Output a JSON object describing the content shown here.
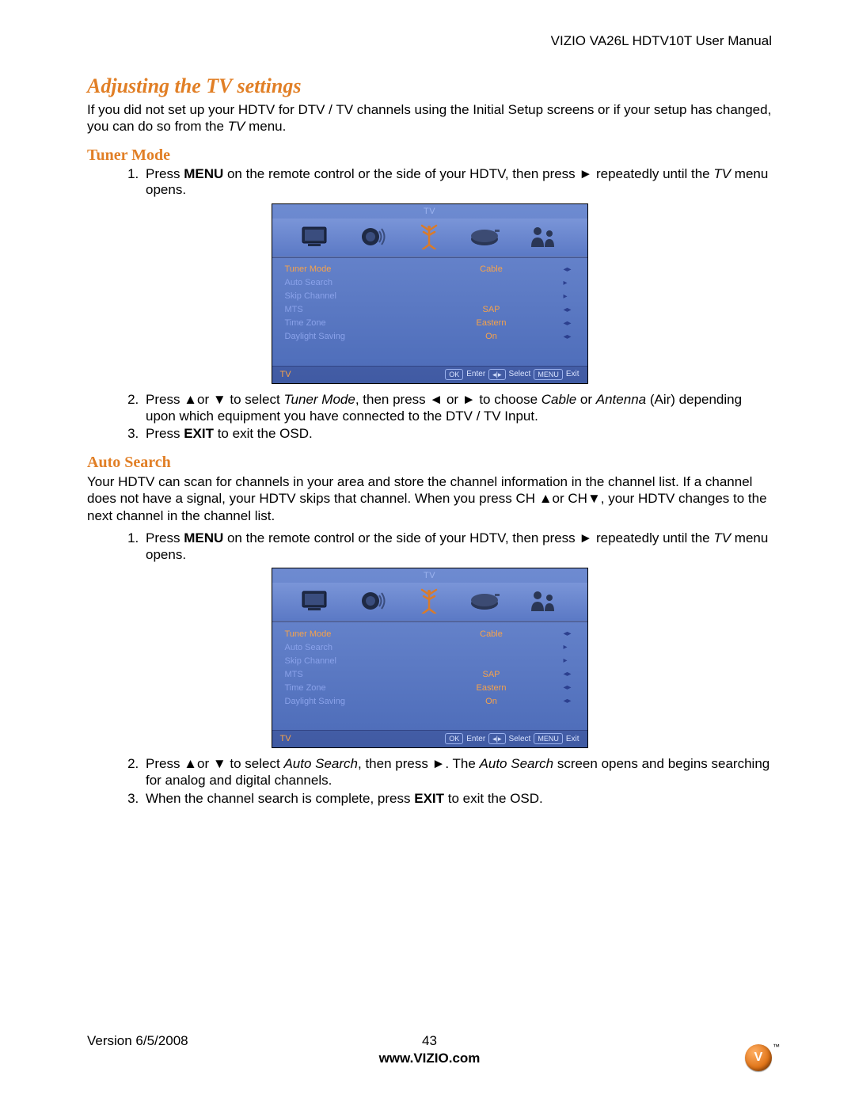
{
  "header": {
    "title": "VIZIO VA26L HDTV10T User Manual"
  },
  "section1": {
    "title": "Adjusting the TV settings",
    "intro_a": "If you did not set up your HDTV for DTV / TV channels using the Initial Setup screens or if your setup has changed, you can do so from the ",
    "intro_ital": "TV",
    "intro_b": " menu."
  },
  "tuner": {
    "title": "Tuner Mode",
    "step1_a": "Press ",
    "step1_menu": "MENU",
    "step1_b": " on the remote control or the side of your HDTV, then press ► repeatedly until the ",
    "step1_ital": "TV",
    "step1_c": " menu opens.",
    "step2_a": "Press ▲or ▼ to select ",
    "step2_ital1": "Tuner Mode",
    "step2_b": ", then press ◄ or ► to choose ",
    "step2_ital2": "Cable",
    "step2_c": " or ",
    "step2_ital3": "Antenna",
    "step2_d": " (Air) depending upon which equipment you have connected to the DTV / TV Input.",
    "step3_a": "Press ",
    "step3_exit": "EXIT",
    "step3_b": " to exit the OSD."
  },
  "auto": {
    "title": "Auto Search",
    "intro": "Your HDTV can scan for channels in your area and store the channel information in the channel list. If a channel does not have a signal, your HDTV skips that channel. When you press CH ▲or CH▼, your HDTV changes to the next channel in the channel list.",
    "step1_a": "Press ",
    "step1_menu": "MENU",
    "step1_b": " on the remote control or the side of your HDTV, then press ► repeatedly until the ",
    "step1_ital": "TV",
    "step1_c": " menu opens.",
    "step2_a": "Press ▲or ▼ to select ",
    "step2_ital1": "Auto Search",
    "step2_b": ", then press ►. The ",
    "step2_ital2": "Auto Search",
    "step2_c": " screen opens and begins searching for analog and digital channels.",
    "step3_a": "When the channel search is complete, press ",
    "step3_exit": "EXIT",
    "step3_b": " to exit the OSD."
  },
  "osd": {
    "title": "TV",
    "items": [
      {
        "label": "Tuner Mode",
        "value": "Cable",
        "arrow": "◂▸",
        "selected": true
      },
      {
        "label": "Auto Search",
        "value": "",
        "arrow": "▸"
      },
      {
        "label": "Skip Channel",
        "value": "",
        "arrow": "▸"
      },
      {
        "label": "MTS",
        "value": "SAP",
        "arrow": "◂▸"
      },
      {
        "label": "Time Zone",
        "value": "Eastern",
        "arrow": "◂▸"
      },
      {
        "label": "Daylight Saving",
        "value": "On",
        "arrow": "◂▸"
      }
    ],
    "footer": {
      "tv": "TV",
      "ok": "OK",
      "enter": "Enter",
      "sel": "◂|▸",
      "select": "Select",
      "menu": "MENU",
      "exit": "Exit"
    }
  },
  "footer": {
    "version": "Version 6/5/2008",
    "page": "43",
    "site": "www.VIZIO.com"
  }
}
